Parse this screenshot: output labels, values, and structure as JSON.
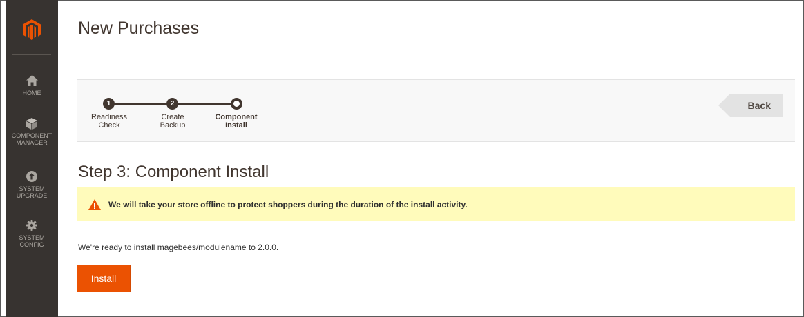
{
  "page": {
    "title": "New Purchases"
  },
  "sidebar": {
    "items": [
      {
        "label": "HOME",
        "icon": "home-icon"
      },
      {
        "label": "COMPONENT MANAGER",
        "icon": "cube-icon"
      },
      {
        "label": "SYSTEM UPGRADE",
        "icon": "upgrade-icon"
      },
      {
        "label": "SYSTEM CONFIG",
        "icon": "gear-icon"
      }
    ]
  },
  "progress": {
    "steps": [
      {
        "number": "1",
        "label_line1": "Readiness",
        "label_line2": "Check"
      },
      {
        "number": "2",
        "label_line1": "Create",
        "label_line2": "Backup"
      },
      {
        "number": "",
        "label_line1": "Component",
        "label_line2": "Install"
      }
    ],
    "back_label": "Back"
  },
  "step": {
    "heading": "Step 3: Component Install",
    "notice": "We will take your store offline to protect shoppers during the duration of the install activity.",
    "ready_text": "We're ready to install magebees/modulename to 2.0.0.",
    "install_label": "Install"
  },
  "colors": {
    "sidebar_bg": "#373330",
    "accent": "#eb5202",
    "notice_bg": "#fffbbb",
    "progress_dark": "#41362f"
  }
}
